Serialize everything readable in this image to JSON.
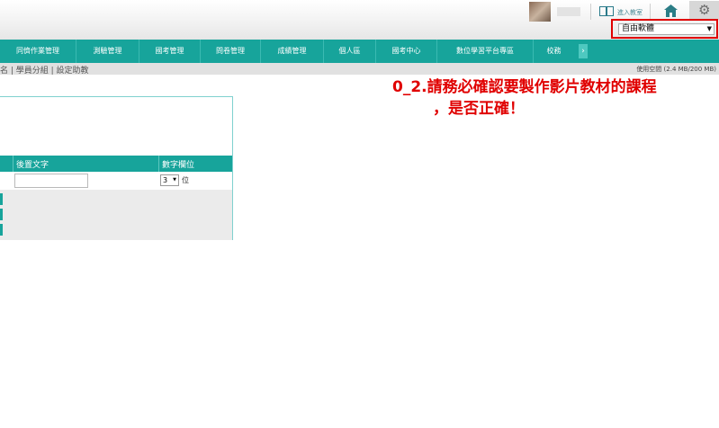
{
  "header": {
    "classroom_label": "進入教室",
    "font_select_value": "自由軟體"
  },
  "nav": {
    "items": [
      {
        "label": "同儕作業管理"
      },
      {
        "label": "測驗管理"
      },
      {
        "label": "國考管理"
      },
      {
        "label": "問卷管理"
      },
      {
        "label": "成績管理"
      },
      {
        "label": "個人區"
      },
      {
        "label": "國考中心"
      },
      {
        "label": "數位學習平台專區"
      },
      {
        "label": "校務"
      }
    ],
    "more_label": "›"
  },
  "subnav": {
    "links": "名 | 學員分組 | 設定助教",
    "storage": "使用空間 (2.4 MB/200 MB)"
  },
  "table": {
    "col_suffix": "後置文字",
    "col_digits": "數字欄位",
    "digit_value": "3",
    "digit_unit": "位"
  },
  "annotation": {
    "line1": "0_2.請務必確認要製作影片教材的課程",
    "line2": "，是否正確！"
  },
  "colors": {
    "nav_bg": "#17a49b",
    "highlight_border": "#e00000",
    "annotation_text": "#e00000"
  },
  "icons": [
    "classroom-icon",
    "home-icon",
    "gear-icon",
    "chevron-right-icon",
    "dropdown-arrow-icon"
  ]
}
